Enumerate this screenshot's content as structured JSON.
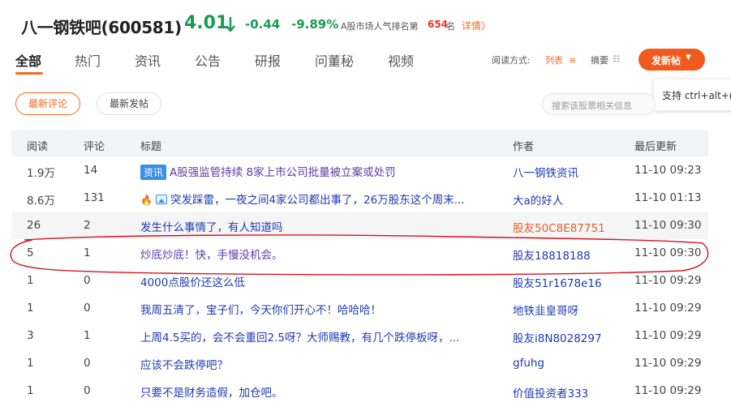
{
  "stock": {
    "name": "八一钢铁吧(600581)",
    "price": "4.01",
    "change": "-0.44",
    "change_pct": "-9.89%",
    "rank_label": "A股市场人气排名第",
    "rank_num": "654",
    "rank_unit": "名",
    "detail_link": "详情",
    "detail_chevron": "〉"
  },
  "tabs": [
    {
      "label": "全部",
      "active": true
    },
    {
      "label": "热门"
    },
    {
      "label": "资讯"
    },
    {
      "label": "公告"
    },
    {
      "label": "研报"
    },
    {
      "label": "问董秘"
    },
    {
      "label": "视频"
    }
  ],
  "read_mode": {
    "label": "阅读方式:",
    "list": "列表",
    "summary": "摘要",
    "list_icon": "≡",
    "summary_icon": "☷"
  },
  "post_button": {
    "label": "发新帖",
    "caret": "▼"
  },
  "tooltip": "支持 ctrl+alt+r",
  "filters": {
    "latest_comment": "最新评论",
    "latest_post": "最新发帖"
  },
  "search": {
    "placeholder": "搜索该股票相关信息"
  },
  "table": {
    "headers": {
      "read": "阅读",
      "comment": "评论",
      "title": "标题",
      "author": "作者",
      "updated": "最后更新"
    },
    "rows": [
      {
        "read": "1.9万",
        "comment": "14",
        "tag": "资讯",
        "title": "A股强监管持续 8家上市公司批量被立案或处罚",
        "author": "八一钢铁资讯",
        "time": "11-10 09:23"
      },
      {
        "read": "8.6万",
        "comment": "131",
        "title": "突发踩雷，一夜之间4家公司都出事了，26万股东这个周末...",
        "author": "大a的好人",
        "time": "11-10 01:13"
      },
      {
        "read": "26",
        "comment": "2",
        "title": "发生什么事情了，有人知道吗",
        "author": "股友50C8E87751",
        "time": "11-10 09:30"
      },
      {
        "read": "5",
        "comment": "1",
        "title": "炒底炒底！快，手慢没机会。",
        "author": "股友18818188",
        "time": "11-10 09:30"
      },
      {
        "read": "1",
        "comment": "0",
        "title": "4000点股价还这么低",
        "author": "股友51r1678e16",
        "time": "11-10 09:29"
      },
      {
        "read": "1",
        "comment": "0",
        "title": "我周五清了，宝子们，今天你们开心不！哈哈哈！",
        "author": "地铁韭皇哥呀",
        "time": "11-10 09:29"
      },
      {
        "read": "3",
        "comment": "1",
        "title": "上周4.5买的，会不会重回2.5呀？大师赐教，有几个跌停板呀，...",
        "author": "股友i8N8028297",
        "time": "11-10 09:29"
      },
      {
        "read": "1",
        "comment": "0",
        "title": "应该不会跌停吧？",
        "author": "gfuhg",
        "time": "11-10 09:29"
      },
      {
        "read": "1",
        "comment": "0",
        "title": "只要不是财务造假，加仓吧。",
        "author": "价值投资者333",
        "time": "11-10 09:29"
      }
    ]
  },
  "colors": {
    "accent": "#f26a22",
    "down": "#1a9a52",
    "link": "#1d3bb3",
    "annotation": "#d8141f"
  }
}
